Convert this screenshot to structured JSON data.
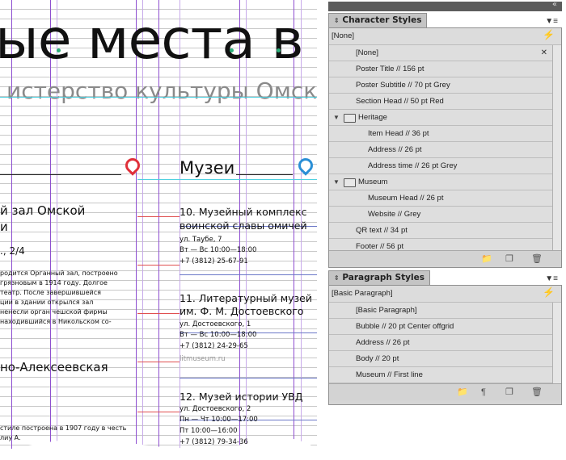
{
  "document": {
    "headline": "ые места в Ом",
    "subtitle": "истерство культуры Омско",
    "section_museums": "Музеи",
    "left_heading_1": "й зал Омской",
    "left_heading_1b": "и",
    "left_address": "., 2/4",
    "left_body": [
      "родится Органный зал, построено",
      "грязновым в 1914 году. Долгое",
      "театр. После завершившейся",
      "ции в здании открылся зал",
      "ненесли орган чешской фирмы",
      "находившийся в Никольском со-"
    ],
    "left_heading_2": "но-Алексеевская",
    "left_body_2": [
      "стиле построена в 1907 году в честь",
      "лиу А."
    ],
    "museums": [
      {
        "title_1": "10. Музейный комплекс",
        "title_2": "воинской славы омичей",
        "lines": [
          "ул. Таубе, 7",
          "Вт — Вс 10:00—18:00",
          "+7 (3812) 25-67-91"
        ]
      },
      {
        "title_1": "11. Литературный музей",
        "title_2": "им. Ф. М. Достоевского",
        "lines": [
          "ул. Достоевского, 1",
          "Вт — Вс 10:00—18:00",
          "+7 (3812) 24-29-65",
          "litmuseum.ru"
        ]
      },
      {
        "title_1": "12. Музей истории УВД",
        "title_2": "",
        "lines": [
          "ул. Достоевского, 2",
          "Пн — Чт 10:00—17:00",
          "Пт 10:00—16:00",
          "+7 (3812) 79-34-36"
        ]
      }
    ]
  },
  "character_styles": {
    "tab": "Character Styles",
    "current": "[None]",
    "items": [
      {
        "label": "[None]",
        "level": 1
      },
      {
        "label": "Poster Title // 156 pt",
        "level": 1
      },
      {
        "label": "Poster Subtitle // 70 pt Grey",
        "level": 1
      },
      {
        "label": "Section Head // 50 pt Red",
        "level": 1
      },
      {
        "label": "Heritage",
        "level": 0,
        "folder": true
      },
      {
        "label": "Item Head // 36 pt",
        "level": 2
      },
      {
        "label": "Address // 26 pt",
        "level": 2
      },
      {
        "label": "Address time // 26 pt Grey",
        "level": 2
      },
      {
        "label": "Museum",
        "level": 0,
        "folder": true
      },
      {
        "label": "Museum Head // 26 pt",
        "level": 2
      },
      {
        "label": "Website // Grey",
        "level": 2
      },
      {
        "label": "QR text // 34 pt",
        "level": 1
      },
      {
        "label": "Footer // 56 pt",
        "level": 1
      }
    ]
  },
  "paragraph_styles": {
    "tab": "Paragraph Styles",
    "current": "[Basic Paragraph]",
    "items": [
      {
        "label": "[Basic Paragraph]"
      },
      {
        "label": "Bubble // 20 pt Center offgrid"
      },
      {
        "label": "Address // 26 pt"
      },
      {
        "label": "Body // 20 pt"
      },
      {
        "label": "Museum // First line"
      }
    ]
  },
  "colors": {
    "accent_red": "#e0303a",
    "accent_blue": "#2a8fd6",
    "guide_purple": "#8e4fd0",
    "dot_green": "#2bb07a"
  }
}
